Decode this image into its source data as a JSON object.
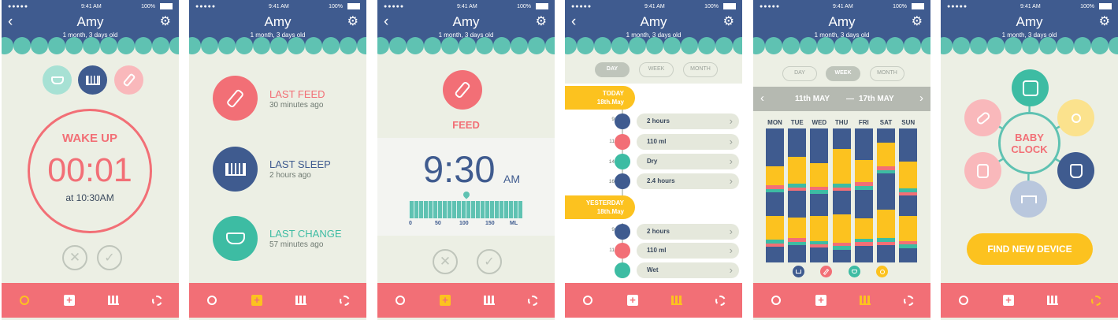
{
  "status": {
    "time": "9:41 AM",
    "battery": "100%"
  },
  "profile": {
    "name": "Amy",
    "age": "1 month, 3 days old"
  },
  "colors": {
    "header": "#3f5b8f",
    "teal": "#5fc2b2",
    "pink": "#f26f76",
    "yellow": "#fcc21f",
    "background": "#ecefe4"
  },
  "icons": {
    "back": "back-arrow-icon",
    "settings": "gear-icon",
    "diaper": "diaper-icon",
    "crib": "crib-icon",
    "bottle": "bottle-icon",
    "timer": "stopwatch-icon",
    "add": "plus-icon",
    "stats": "bar-chart-icon",
    "cycle": "cycle-icon"
  },
  "timer": {
    "title": "WAKE UP",
    "value": "00:01",
    "at": "at 10:30AM"
  },
  "last": [
    {
      "label": "LAST FEED",
      "ago": "30 minutes ago"
    },
    {
      "label": "LAST SLEEP",
      "ago": "2 hours ago"
    },
    {
      "label": "LAST CHANGE",
      "ago": "57 minutes ago"
    }
  ],
  "feed": {
    "title": "FEED",
    "time": "9:30",
    "ampm": "AM",
    "ticks": [
      "0",
      "50",
      "100",
      "150",
      "ML"
    ],
    "ruler_value_ml": 50
  },
  "log": {
    "tabs": [
      "DAY",
      "WEEK",
      "MONTH"
    ],
    "days": [
      {
        "label": "TODAY",
        "date": "18th.May",
        "entries": [
          {
            "time": "9:30",
            "text": "2 hours"
          },
          {
            "time": "11:45",
            "text": "110 ml"
          },
          {
            "time": "14:10",
            "text": "Dry"
          },
          {
            "time": "16:45",
            "text": "2.4 hours"
          }
        ]
      },
      {
        "label": "YESTERDAY",
        "date": "18th.May",
        "entries": [
          {
            "time": "9:45",
            "text": "2 hours"
          },
          {
            "time": "11:20",
            "text": "110 ml"
          },
          {
            "time": "",
            "text": "Wet"
          }
        ]
      }
    ]
  },
  "week": {
    "tabs": [
      "DAY",
      "WEEK",
      "MONTH"
    ],
    "range_start": "11th MAY",
    "dash": "—",
    "range_end": "17th MAY",
    "prev": "‹",
    "next": "›",
    "days": [
      "MON",
      "TUE",
      "WED",
      "THU",
      "FRI",
      "SAT",
      "SUN"
    ]
  },
  "hub": {
    "title1": "BABY",
    "title2": "CLOCK",
    "button": "FIND NEW DEVICE"
  }
}
